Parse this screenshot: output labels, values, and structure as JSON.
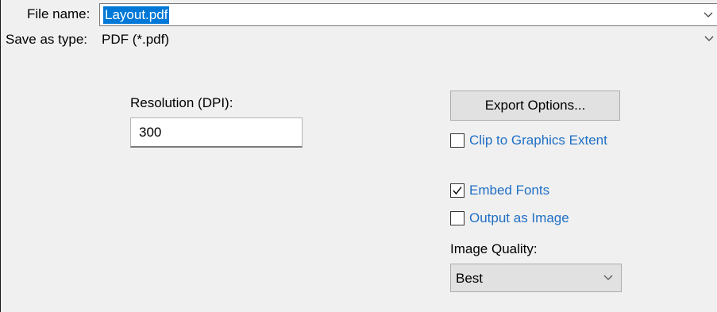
{
  "file_name": {
    "label": "File name:",
    "value": "Layout.pdf"
  },
  "save_as_type": {
    "label": "Save as type:",
    "value": "PDF (*.pdf)"
  },
  "resolution": {
    "label": "Resolution (DPI):",
    "value": "300"
  },
  "export_options": {
    "label": "Export Options..."
  },
  "options": {
    "clip_to_graphics_extent": {
      "label": "Clip to Graphics Extent",
      "checked": false
    },
    "embed_fonts": {
      "label": "Embed Fonts",
      "checked": true
    },
    "output_as_image": {
      "label": "Output as Image",
      "checked": false
    }
  },
  "image_quality": {
    "label": "Image Quality:",
    "value": "Best"
  },
  "icons": {
    "dropdown": "chevron-down-icon",
    "check": "checkmark-icon"
  },
  "colors": {
    "selection": "#0078d7",
    "link_label": "#1f6fc5",
    "background": "#f0f0f0"
  }
}
